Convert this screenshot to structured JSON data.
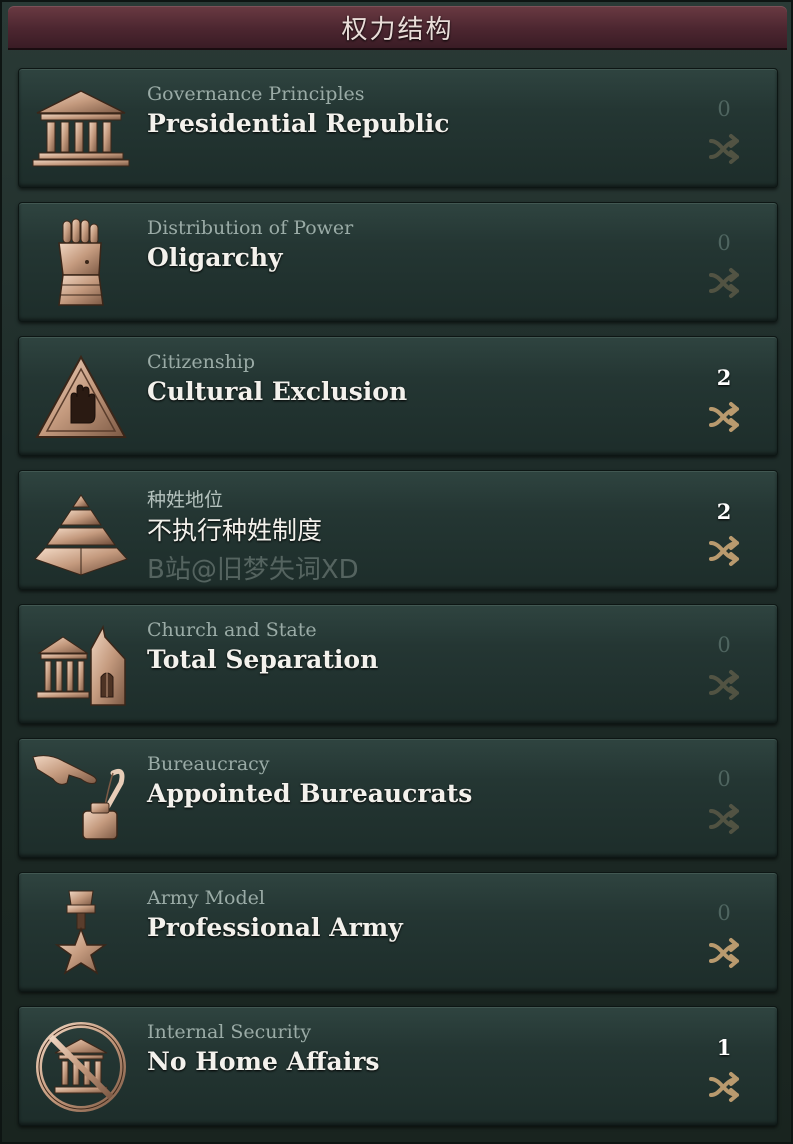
{
  "panel": {
    "title": "权力结构"
  },
  "laws": [
    {
      "category": "Governance Principles",
      "value": "Presidential Republic",
      "count": "0",
      "icon": "parliament-building-icon"
    },
    {
      "category": "Distribution of Power",
      "value": "Oligarchy",
      "count": "0",
      "icon": "gauntlet-icon"
    },
    {
      "category": "Citizenship",
      "value": "Cultural Exclusion",
      "count": "2",
      "icon": "raised-hand-warning-icon"
    },
    {
      "category": "种姓地位",
      "value": "不执行种姓制度",
      "count": "2",
      "icon": "pyramid-icon",
      "watermark": "B站@旧梦失词XD"
    },
    {
      "category": "Church and State",
      "value": "Total Separation",
      "count": "0",
      "icon": "church-and-state-icon"
    },
    {
      "category": "Bureaucracy",
      "value": "Appointed Bureaucrats",
      "count": "0",
      "icon": "quill-and-ink-icon"
    },
    {
      "category": "Army Model",
      "value": "Professional Army",
      "count": "0",
      "icon": "star-medal-icon"
    },
    {
      "category": "Internal Security",
      "value": "No Home Affairs",
      "count": "1",
      "icon": "prohibited-building-icon"
    }
  ],
  "colors": {
    "title_bar": "#4c2630",
    "row_background": "#243633",
    "icon_bronze": "#c9a48a",
    "swap_icon": "#b99a6e"
  }
}
